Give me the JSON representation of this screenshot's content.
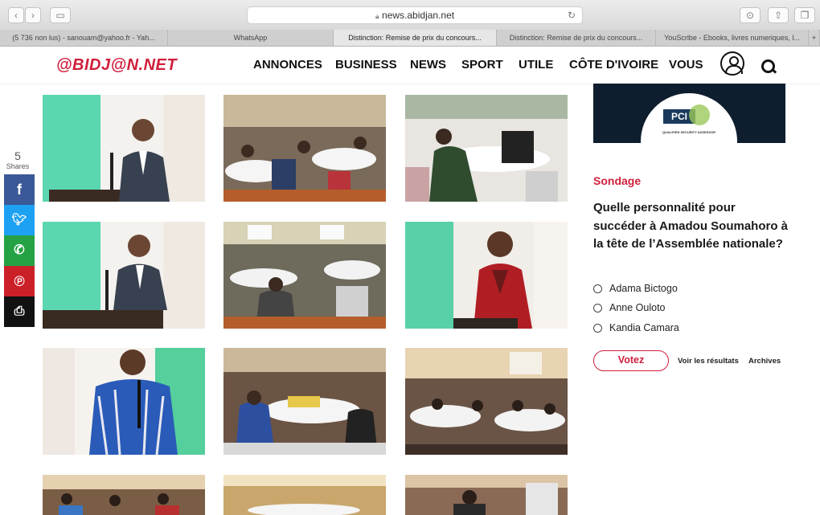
{
  "browser": {
    "url": "news.abidjan.net",
    "tabs": [
      {
        "label": "(5 736 non lus) - sanouam@yahoo.fr - Yah..."
      },
      {
        "label": "WhatsApp"
      },
      {
        "label": "Distinction: Remise de prix du concours..."
      },
      {
        "label": "Distinction: Remise de prix du concours..."
      },
      {
        "label": "YouScribe - Ebooks, livres numeriques, l..."
      }
    ]
  },
  "site": {
    "logo": "@BIDJ@N.NET",
    "nav": [
      "ANNONCES",
      "BUSINESS",
      "NEWS",
      "SPORT",
      "UTILE",
      "CÔTE D'IVOIRE",
      "VOUS"
    ]
  },
  "share": {
    "count": "5",
    "label": "Shares"
  },
  "ad": {
    "brand": "PCI",
    "caption": "QUALIFIED SECURITY ASSESSOR"
  },
  "poll": {
    "section": "Sondage",
    "question": "Quelle personnalité pour succéder à Amadou Soumahoro à la tête de l’Assemblée nationale?",
    "options": [
      "Adama Bictogo",
      "Anne Ouloto",
      "Kandia Camara"
    ],
    "vote_label": "Votez",
    "results_label": "Voir les résultats",
    "archives_label": "Archives"
  },
  "colors": {
    "brand": "#d01f3c",
    "facebook": "#3b5998",
    "twitter": "#1da1f2",
    "whatsapp": "#25a244",
    "pinterest": "#cb2027",
    "print": "#111111"
  }
}
